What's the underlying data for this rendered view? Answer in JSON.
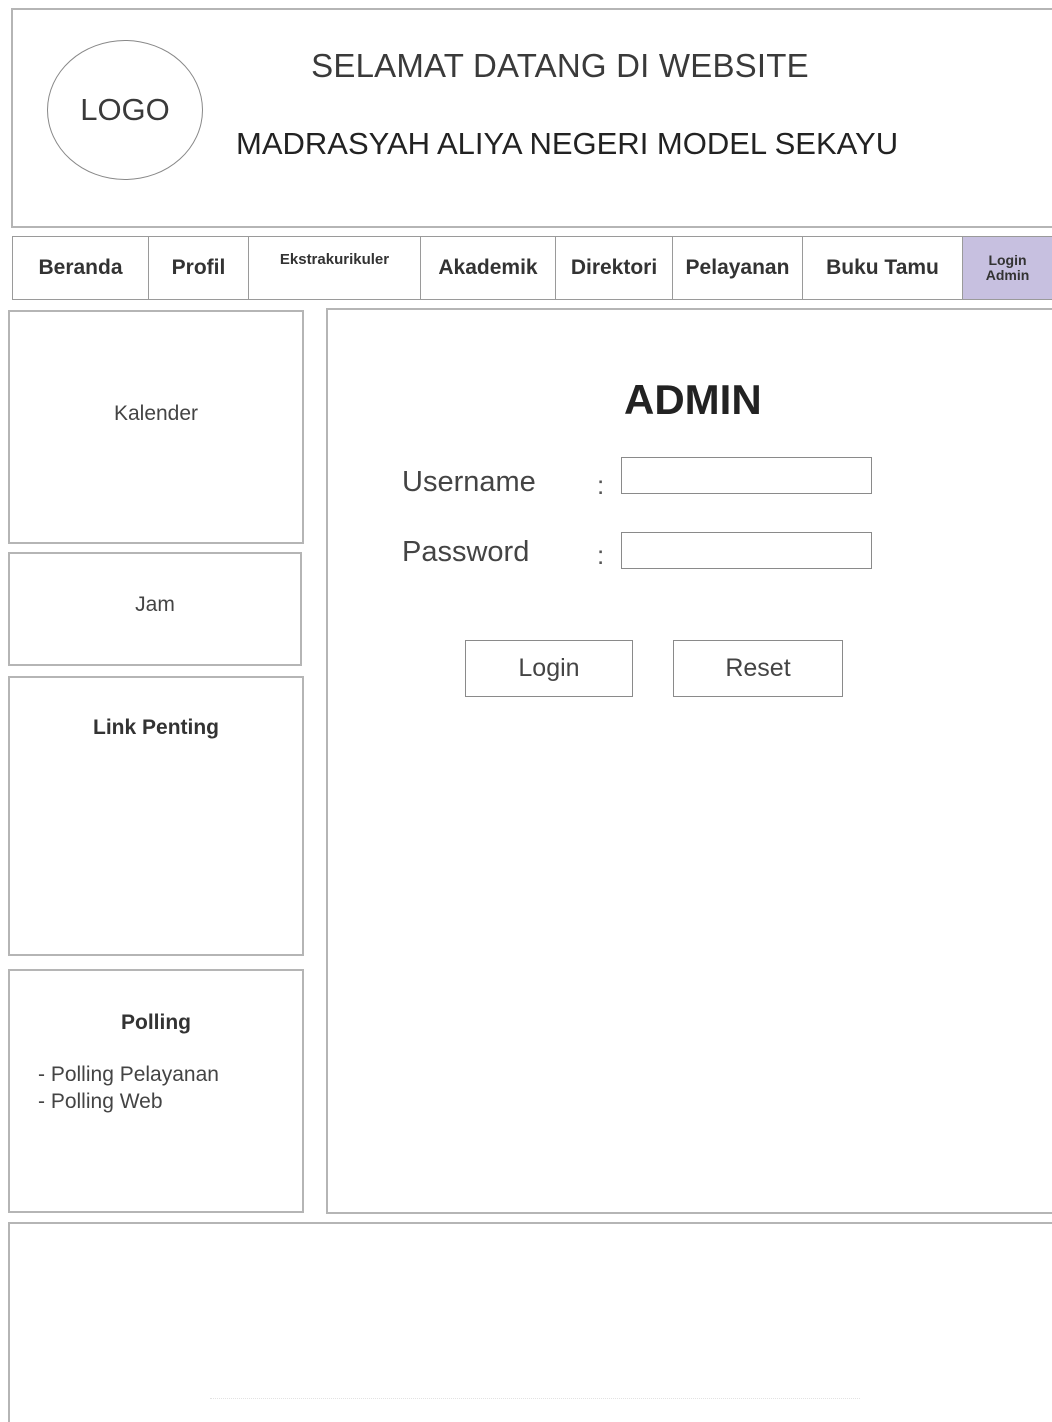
{
  "header": {
    "logo_text": "LOGO",
    "welcome_title": "SELAMAT DATANG DI WEBSITE",
    "school_name": "MADRASYAH ALIYA NEGERI MODEL SEKAYU"
  },
  "nav": {
    "items": [
      {
        "label": "Beranda"
      },
      {
        "label": "Profil"
      },
      {
        "label": "Ekstrakurikuler"
      },
      {
        "label": "Akademik"
      },
      {
        "label": "Direktori"
      },
      {
        "label": "Pelayanan"
      },
      {
        "label": "Buku Tamu"
      },
      {
        "label": "Login\nAdmin"
      }
    ],
    "active_color": "#c7c0e0"
  },
  "sidebar": {
    "kalender_label": "Kalender",
    "jam_label": "Jam",
    "link_penting_title": "Link Penting",
    "polling_title": "Polling",
    "polling_items": [
      "- Polling Pelayanan",
      "- Polling Web"
    ]
  },
  "main": {
    "title": "ADMIN",
    "username_label": "Username",
    "password_label": "Password",
    "colon": ":",
    "username_value": "",
    "password_value": "",
    "login_button": "Login",
    "reset_button": "Reset"
  }
}
